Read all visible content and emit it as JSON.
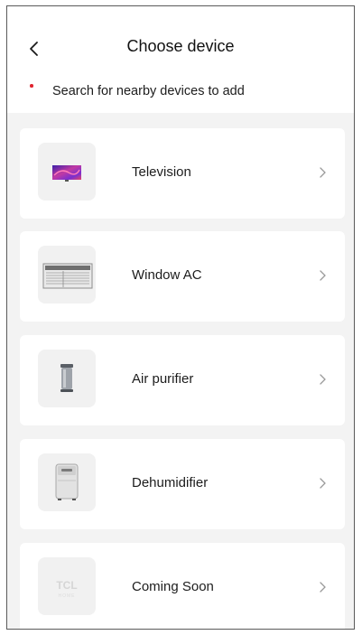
{
  "header": {
    "title": "Choose device",
    "hint": "Search for nearby devices to add"
  },
  "devices": [
    {
      "label": "Television",
      "icon": "television-icon"
    },
    {
      "label": "Window AC",
      "icon": "window-ac-icon"
    },
    {
      "label": "Air purifier",
      "icon": "air-purifier-icon"
    },
    {
      "label": "Dehumidifier",
      "icon": "dehumidifier-icon"
    },
    {
      "label": "Coming Soon",
      "icon": "tcl-home-logo"
    }
  ],
  "colors": {
    "accent_dot": "#e0242f",
    "background": "#f3f3f3",
    "card": "#ffffff",
    "chevron": "#9a9a9a"
  },
  "logo_text": "TCL HOME"
}
